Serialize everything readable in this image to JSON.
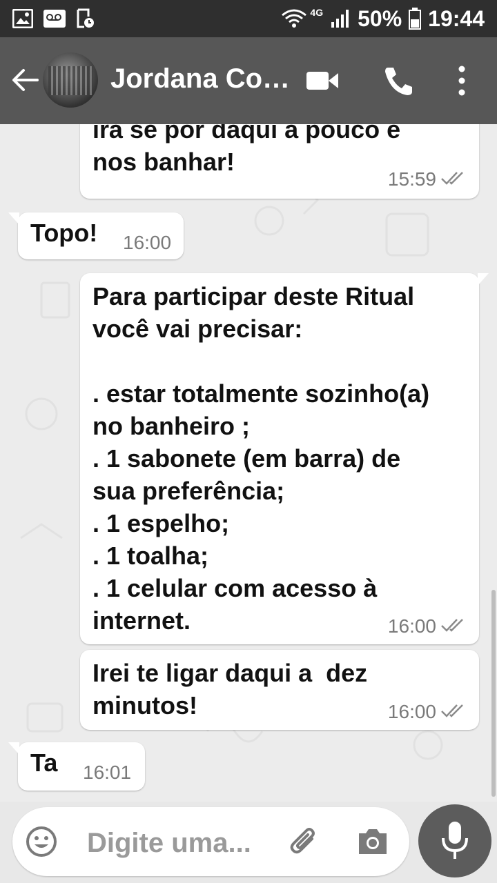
{
  "status_bar": {
    "network": "4G",
    "battery": "50%",
    "time": "19:44"
  },
  "header": {
    "contact_name": "Jordana Co…"
  },
  "messages": [
    {
      "direction": "out",
      "text": "irá se por daqui a pouco e\nnos banhar!",
      "time": "15:59"
    },
    {
      "direction": "in",
      "text": "Topo!",
      "time": "16:00"
    },
    {
      "direction": "out",
      "text": "Para participar deste Ritual\nvocê vai precisar:\n\n. estar totalmente sozinho(a)\nno banheiro ;\n. 1 sabonete (em barra) de\nsua preferência;\n. 1 espelho;\n. 1 toalha;\n. 1 celular com acesso à\ninternet.",
      "time": "16:00"
    },
    {
      "direction": "out",
      "text": "Irei te ligar daqui a  dez\nminutos!",
      "time": "16:00"
    },
    {
      "direction": "in",
      "text": "Ta",
      "time": "16:01"
    }
  ],
  "composer": {
    "placeholder": "Digite uma..."
  },
  "colors": {
    "app_bar": "#575757",
    "status_bar": "#2f2f2f",
    "chat_background": "#ececec",
    "bubble": "#ffffff",
    "mic_button": "#5c5c5c"
  },
  "icons": [
    "image-icon",
    "voicemail-icon",
    "schedule-icon",
    "wifi-icon",
    "signal-icon",
    "battery-icon",
    "back-arrow-icon",
    "video-call-icon",
    "phone-icon",
    "more-options-icon",
    "emoji-icon",
    "attach-icon",
    "camera-icon",
    "mic-icon",
    "double-check-icon"
  ]
}
